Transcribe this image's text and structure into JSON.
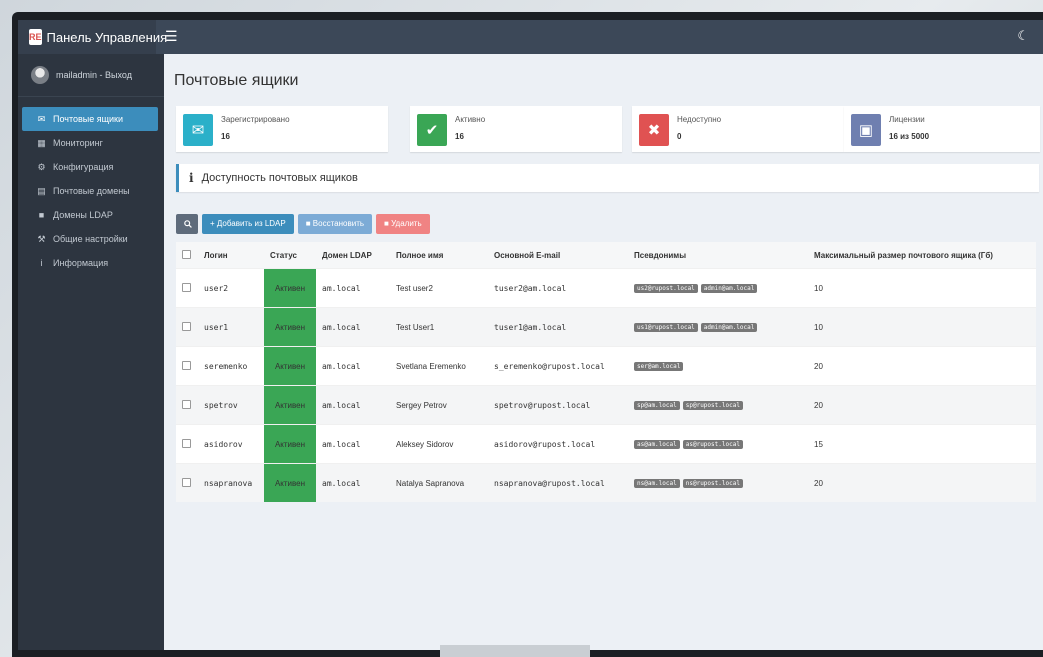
{
  "brand": {
    "logo": "RE",
    "title": "Панель Управления"
  },
  "header": {
    "menu_icon": "hamburger-icon",
    "theme_icon": "moon-icon"
  },
  "user": {
    "label": "mailadmin - Выход"
  },
  "sidebar": {
    "items": [
      {
        "label": "Почтовые ящики",
        "icon": "mailbox-icon",
        "glyph": "✉",
        "active": true
      },
      {
        "label": "Мониторинг",
        "icon": "grid-icon",
        "glyph": "▦",
        "active": false
      },
      {
        "label": "Конфигурация",
        "icon": "gear-icon",
        "glyph": "⚙",
        "active": false
      },
      {
        "label": "Почтовые домены",
        "icon": "inbox-icon",
        "glyph": "▤",
        "active": false
      },
      {
        "label": "Домены LDAP",
        "icon": "book-icon",
        "glyph": "■",
        "active": false
      },
      {
        "label": "Общие настройки",
        "icon": "wrench-icon",
        "glyph": "⚒",
        "active": false
      },
      {
        "label": "Информация",
        "icon": "info-icon",
        "glyph": "i",
        "active": false
      }
    ]
  },
  "page": {
    "title": "Почтовые ящики"
  },
  "stats": [
    {
      "label": "Зарегистрировано",
      "value": "16",
      "icon": "envelope-icon",
      "glyph": "✉",
      "color": "#2bb0c9"
    },
    {
      "label": "Активно",
      "value": "16",
      "icon": "check-icon",
      "glyph": "✔",
      "color": "#3aa655"
    },
    {
      "label": "Недоступно",
      "value": "0",
      "icon": "x-icon",
      "glyph": "✖",
      "color": "#e05252"
    },
    {
      "label": "Лицензии",
      "value": "16 из 5000",
      "icon": "license-icon",
      "glyph": "▣",
      "color": "#6f7fb0"
    }
  ],
  "availability": {
    "title": "Доступность почтовых ящиков",
    "icon": "info-icon"
  },
  "toolbar": {
    "search_icon": "search-icon",
    "add_ldap": "+ Добавить из LDAP",
    "restore": "Восстановить",
    "delete": "Удалить"
  },
  "table": {
    "headers": [
      "Логин",
      "Статус",
      "Домен LDAP",
      "Полное имя",
      "Основной E-mail",
      "Псевдонимы",
      "Максимальный размер почтового ящика (Гб)"
    ],
    "rows": [
      {
        "login": "user2",
        "status": "Активен",
        "domain": "am.local",
        "name": "Test user2",
        "email": "tuser2@am.local",
        "aliases": [
          "us2@rupost.local",
          "admin@am.local"
        ],
        "size": "10"
      },
      {
        "login": "user1",
        "status": "Активен",
        "domain": "am.local",
        "name": "Test User1",
        "email": "tuser1@am.local",
        "aliases": [
          "us1@rupost.local",
          "admin@am.local"
        ],
        "size": "10"
      },
      {
        "login": "seremenko",
        "status": "Активен",
        "domain": "am.local",
        "name": "Svetlana Eremenko",
        "email": "s_eremenko@rupost.local",
        "aliases": [
          "ser@am.local"
        ],
        "size": "20"
      },
      {
        "login": "spetrov",
        "status": "Активен",
        "domain": "am.local",
        "name": "Sergey Petrov",
        "email": "spetrov@rupost.local",
        "aliases": [
          "sp@am.local",
          "sp@rupost.local"
        ],
        "size": "20"
      },
      {
        "login": "asidorov",
        "status": "Активен",
        "domain": "am.local",
        "name": "Aleksey Sidorov",
        "email": "asidorov@rupost.local",
        "aliases": [
          "as@am.local",
          "as@rupost.local"
        ],
        "size": "15"
      },
      {
        "login": "nsapranova",
        "status": "Активен",
        "domain": "am.local",
        "name": "Natalya Sapranova",
        "email": "nsapranova@rupost.local",
        "aliases": [
          "ns@am.local",
          "ns@rupost.local"
        ],
        "size": "20"
      }
    ]
  }
}
